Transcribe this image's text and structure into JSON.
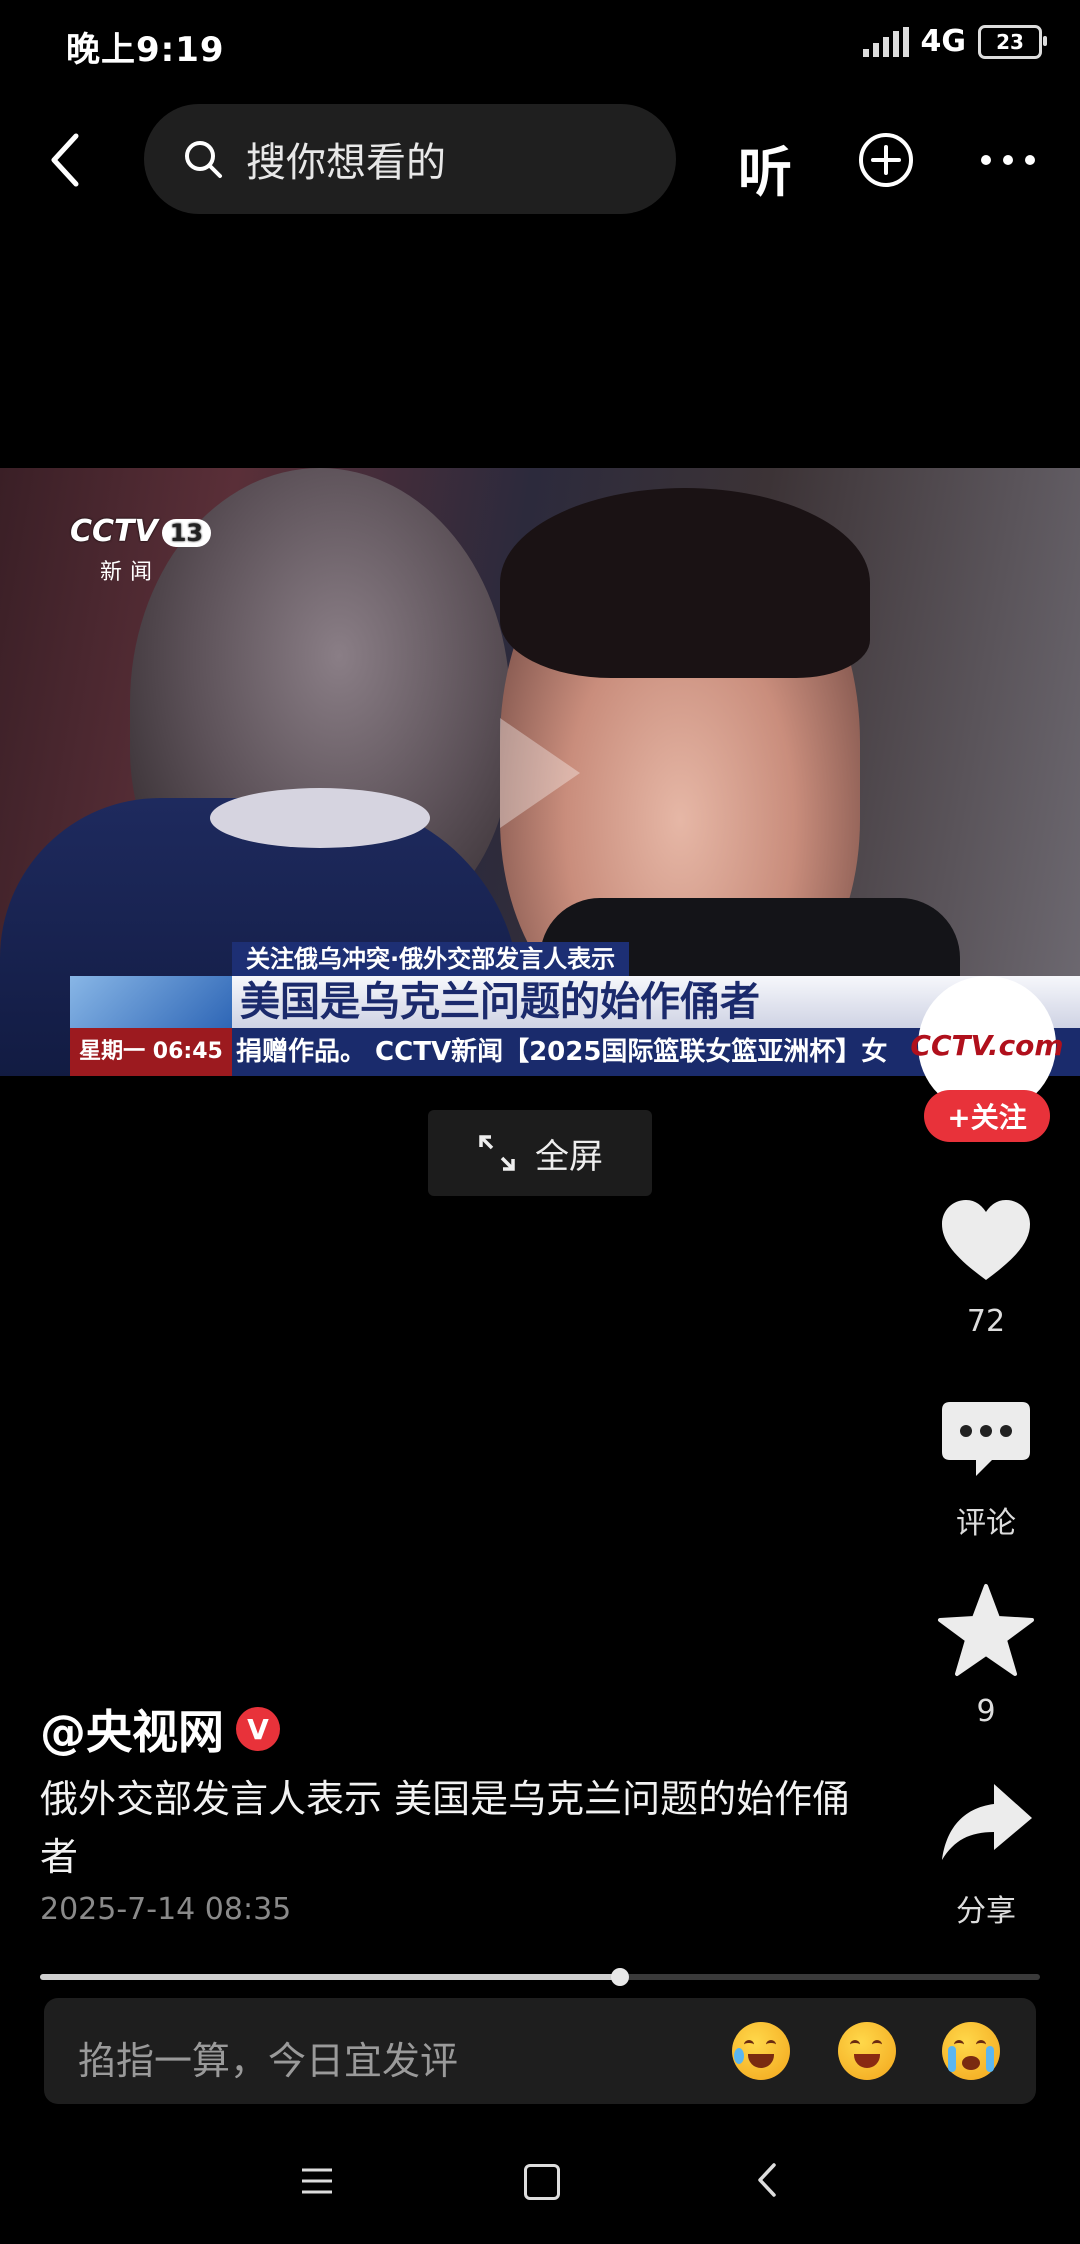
{
  "status_bar": {
    "time": "晚上9:19",
    "network": "4G",
    "battery": "23"
  },
  "top_bar": {
    "search_placeholder": "搜你想看的",
    "listen_label": "听"
  },
  "video": {
    "channel_logo": "CCTV",
    "channel_number": "13",
    "channel_name": "新闻",
    "sub_tag": "关注俄乌冲突·俄外交部发言人表示",
    "headline": "美国是乌克兰问题的始作俑者",
    "weekday_time": "星期一 06:45",
    "ticker": "捐赠作品。 CCTV新闻【2025国际篮联女篮亚洲杯】女"
  },
  "fullscreen_label": "全屏",
  "sidebar": {
    "avatar_text": "CCTV.com",
    "follow_label": "+关注",
    "like_count": "72",
    "comment_label": "评论",
    "favorite_count": "9",
    "share_label": "分享"
  },
  "post": {
    "author": "@央视网",
    "verified_mark": "V",
    "description": "俄外交部发言人表示 美国是乌克兰问题的始作俑者",
    "timestamp": "2025-7-14 08:35"
  },
  "playback": {
    "progress": 0.58
  },
  "comment_box": {
    "placeholder": "掐指一算，今日宜发评"
  },
  "colors": {
    "accent_red": "#e8323a",
    "background": "#000000"
  }
}
